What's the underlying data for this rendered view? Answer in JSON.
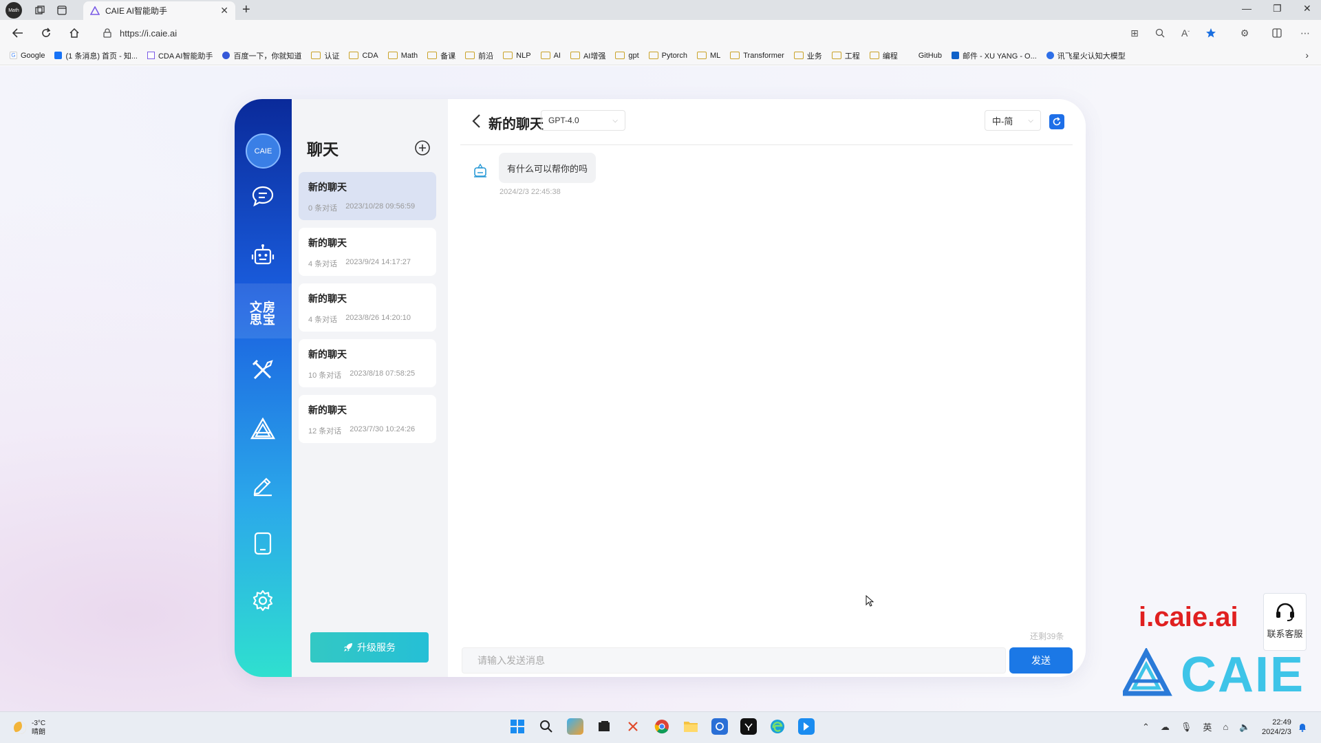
{
  "browser": {
    "profile_label": "Math",
    "tab_title": "CAIE AI智能助手",
    "url": "https://i.caie.ai",
    "bookmarks": [
      {
        "label": "Google",
        "type": "site"
      },
      {
        "label": "(1 条消息) 首页 - 知...",
        "type": "site"
      },
      {
        "label": "CDA AI智能助手",
        "type": "site"
      },
      {
        "label": "百度一下，你就知道",
        "type": "site"
      },
      {
        "label": "认证",
        "type": "folder"
      },
      {
        "label": "CDA",
        "type": "folder"
      },
      {
        "label": "Math",
        "type": "folder"
      },
      {
        "label": "备课",
        "type": "folder"
      },
      {
        "label": "前沿",
        "type": "folder"
      },
      {
        "label": "NLP",
        "type": "folder"
      },
      {
        "label": "AI",
        "type": "folder"
      },
      {
        "label": "AI增强",
        "type": "folder"
      },
      {
        "label": "gpt",
        "type": "folder"
      },
      {
        "label": "Pytorch",
        "type": "folder"
      },
      {
        "label": "ML",
        "type": "folder"
      },
      {
        "label": "Transformer",
        "type": "folder"
      },
      {
        "label": "业务",
        "type": "folder"
      },
      {
        "label": "工程",
        "type": "folder"
      },
      {
        "label": "编程",
        "type": "folder"
      },
      {
        "label": "GitHub",
        "type": "site"
      },
      {
        "label": "邮件 - XU YANG - O...",
        "type": "site"
      },
      {
        "label": "讯飞星火认知大模型",
        "type": "site"
      }
    ]
  },
  "rail": {
    "avatar_label": "CAIE",
    "word_icon": "文房\n思宝",
    "items": [
      "chat",
      "robot",
      "wenfang-sibao",
      "tools",
      "caie",
      "edit",
      "mobile",
      "settings"
    ]
  },
  "chatlist": {
    "title": "聊天",
    "items": [
      {
        "title": "新的聊天",
        "count": "0 条对话",
        "time": "2023/10/28 09:56:59",
        "active": true
      },
      {
        "title": "新的聊天",
        "count": "4 条对话",
        "time": "2023/9/24 14:17:27",
        "active": false
      },
      {
        "title": "新的聊天",
        "count": "4 条对话",
        "time": "2023/8/26 14:20:10",
        "active": false
      },
      {
        "title": "新的聊天",
        "count": "10 条对话",
        "time": "2023/8/18 07:58:25",
        "active": false
      },
      {
        "title": "新的聊天",
        "count": "12 条对话",
        "time": "2023/7/30 10:24:26",
        "active": false
      }
    ],
    "upgrade_label": "升级服务"
  },
  "chat": {
    "title": "新的聊天",
    "model": "GPT-4.0",
    "language": "中-简",
    "messages": [
      {
        "role": "bot",
        "text": "有什么可以帮你的吗",
        "time": "2024/2/3 22:45:38"
      }
    ],
    "remaining": "还剩39条",
    "input_placeholder": "请输入发送消息",
    "send_label": "发送"
  },
  "overlay": {
    "brand_url": "i.caie.ai",
    "brand_name": "CAIE",
    "support_label": "联系客服"
  },
  "taskbar": {
    "temperature": "-3°C",
    "weather": "晴朗",
    "ime": "英",
    "time": "22:49",
    "date": "2024/2/3"
  },
  "colors": {
    "accent": "#1b78e6",
    "rail_top": "#0a2a9a",
    "rail_bottom": "#2fe0cf",
    "upgrade": "#33c8c4",
    "brand_red": "#e02020",
    "brand_cyan": "#3ec4e8"
  }
}
